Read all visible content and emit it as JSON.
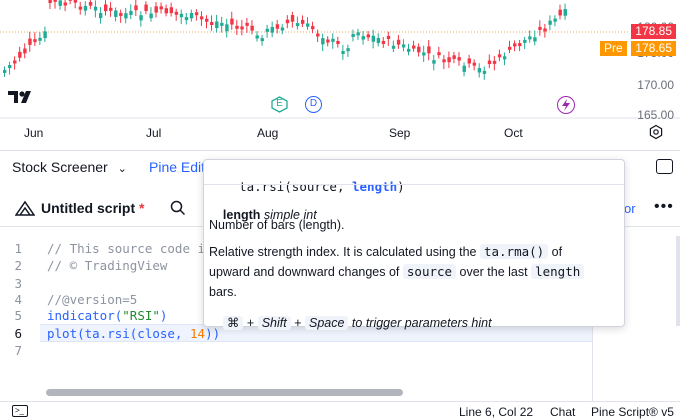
{
  "chart": {
    "price_axis": [
      "180.00",
      "175.00",
      "170.00",
      "165.00"
    ],
    "last_price": "178.85",
    "pre_label": "Pre",
    "pre_price": "178.65",
    "months": [
      "Jun",
      "Jul",
      "Aug",
      "Sep",
      "Oct"
    ],
    "events": {
      "earnings": "E",
      "dividend": "D"
    },
    "logo": "TV",
    "colors": {
      "up": "#22ab94",
      "down": "#f23645",
      "pre": "#ff9800",
      "event_green": "#22ab94",
      "event_blue": "#2962ff",
      "split": "#9c27b0"
    }
  },
  "toolbar": {
    "stock_screener": "Stock Screener",
    "pine_editor": "Pine Edit",
    "script_title": "Untitled script",
    "unsaved_mark": "*",
    "partial_link": "or"
  },
  "editor": {
    "lines": [
      {
        "n": "1",
        "text": "// This source code i"
      },
      {
        "n": "2",
        "text": "// © TradingView"
      },
      {
        "n": "3",
        "text": ""
      },
      {
        "n": "4",
        "text": "//@version=5"
      },
      {
        "n": "5",
        "a": "indicator(",
        "b": "\"RSI\"",
        "c": ")"
      },
      {
        "n": "6",
        "a": "plot(ta.rsi(close, ",
        "b": "14",
        "c": "))"
      },
      {
        "n": "7",
        "text": ""
      }
    ]
  },
  "tooltip": {
    "signature_prefix": "ta.rsi(source, ",
    "signature_param": "length",
    "signature_suffix": ")",
    "param_name": "length",
    "param_type": "simple int",
    "param_desc": "Number of bars (length).",
    "desc_1": "Relative strength index. It is calculated using the ",
    "chip_1": "ta.rma()",
    "desc_2": " of",
    "desc_3": "upward and downward changes of ",
    "chip_2": "source",
    "desc_4": " over the last ",
    "chip_3": "length",
    "desc_5": "bars.",
    "kbd_cmd": "⌘",
    "plus": "+",
    "kbd_shift": "Shift",
    "kbd_space": "Space",
    "hint": "to trigger parameters hint"
  },
  "status": {
    "position": "Line 6, Col 22",
    "chat": "Chat",
    "version": "Pine Script® v5"
  }
}
